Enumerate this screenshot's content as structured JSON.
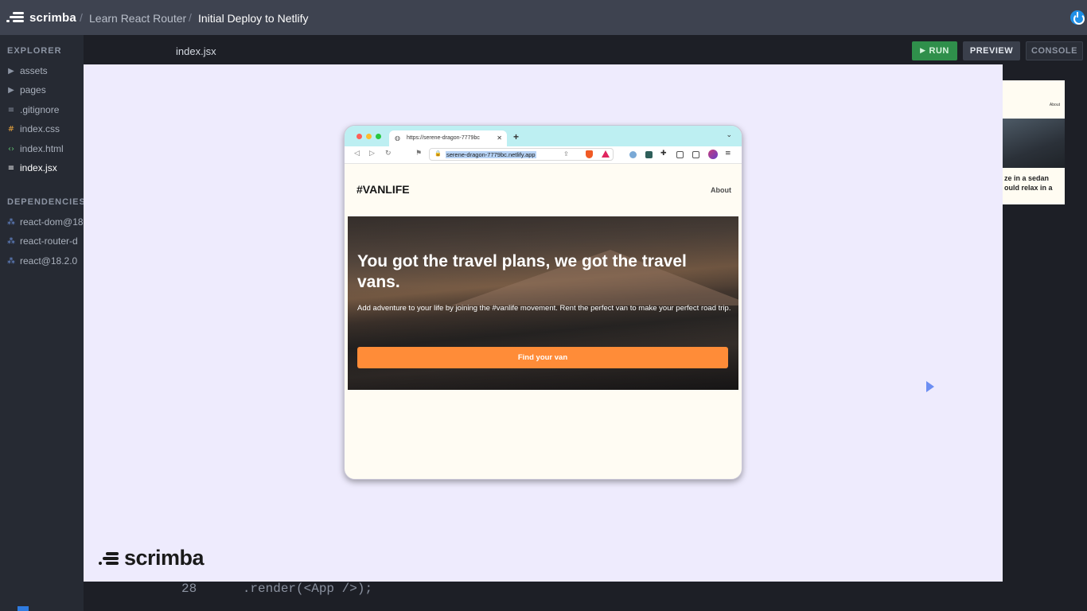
{
  "topbar": {
    "brand": "scrimba",
    "breadcrumbs": [
      "Learn React Router",
      "Initial Deploy to Netlify"
    ]
  },
  "sidebar": {
    "explorer_title": "EXPLORER",
    "files": [
      {
        "label": "assets",
        "icon": "folder-caret-icon"
      },
      {
        "label": "pages",
        "icon": "folder-caret-icon"
      },
      {
        "label": ".gitignore",
        "icon": "text-file-icon"
      },
      {
        "label": "index.css",
        "icon": "hash-icon"
      },
      {
        "label": "index.html",
        "icon": "code-icon"
      },
      {
        "label": "index.jsx",
        "icon": "text-file-icon",
        "active": true
      }
    ],
    "dependencies_title": "DEPENDENCIES",
    "dependencies": [
      "react-dom@18",
      "react-router-d",
      "react@18.2.0"
    ]
  },
  "editor": {
    "tab": "index.jsx",
    "code_peek": "28      .render(<App />);"
  },
  "toolbar": {
    "run_label": "RUN",
    "preview_label": "PREVIEW",
    "console_label": "CONSOLE"
  },
  "background_preview": {
    "about": "About",
    "text_line1": "ze in a sedan",
    "text_line2": "ould relax in a"
  },
  "browser": {
    "tab_title": "https://serene-dragon-7779bc",
    "url": "serene-dragon-7779bc.netlify.app"
  },
  "vanlife": {
    "logo": "#VANLIFE",
    "nav_about": "About",
    "hero_title": "You got the travel plans, we got the travel vans.",
    "hero_subtitle": "Add adventure to your life by joining the #vanlife movement. Rent the perfect van to make your perfect road trip.",
    "hero_button": "Find your van"
  },
  "watermark": "scrimba",
  "colors": {
    "accent_run": "#2f8f4b",
    "cta_orange": "#ff8c38",
    "overlay": "#eeebfd",
    "power_blue": "#1f8fe6"
  }
}
